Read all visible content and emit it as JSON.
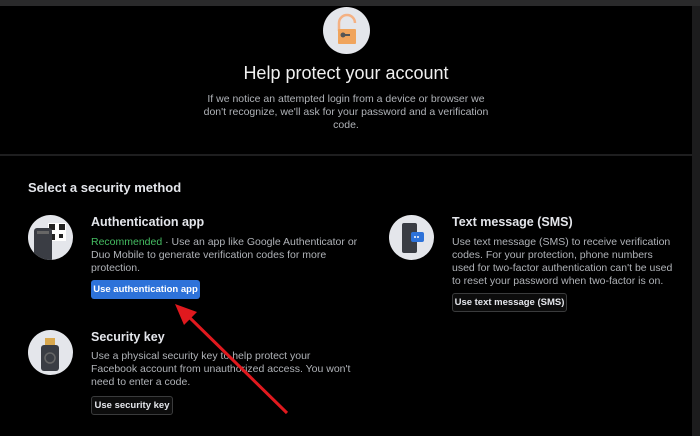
{
  "header": {
    "title": "Help protect your account",
    "subtitle": "If we notice an attempted login from a device or browser we don't recognize, we'll ask for your password and a verification code."
  },
  "section_title": "Select a security method",
  "options": [
    {
      "title": "Authentication app",
      "badge": "Recommended",
      "description": " · Use an app like Google Authenticator or Duo Mobile to generate verification codes for more protection.",
      "button": "Use authentication app"
    },
    {
      "title": "Text message (SMS)",
      "description": "Use text message (SMS) to receive verification codes. For your protection, phone numbers used for two-factor authentication can't be used to reset your password when two-factor is on.",
      "button": "Use text message (SMS)"
    },
    {
      "title": "Security key",
      "description": "Use a physical security key to help protect your Facebook account from unauthorized access. You won't need to enter a code.",
      "button": "Use security key"
    }
  ],
  "colors": {
    "accent": "#2d72d9",
    "recommended": "#45bd62",
    "annotation_arrow": "#e0191e"
  }
}
